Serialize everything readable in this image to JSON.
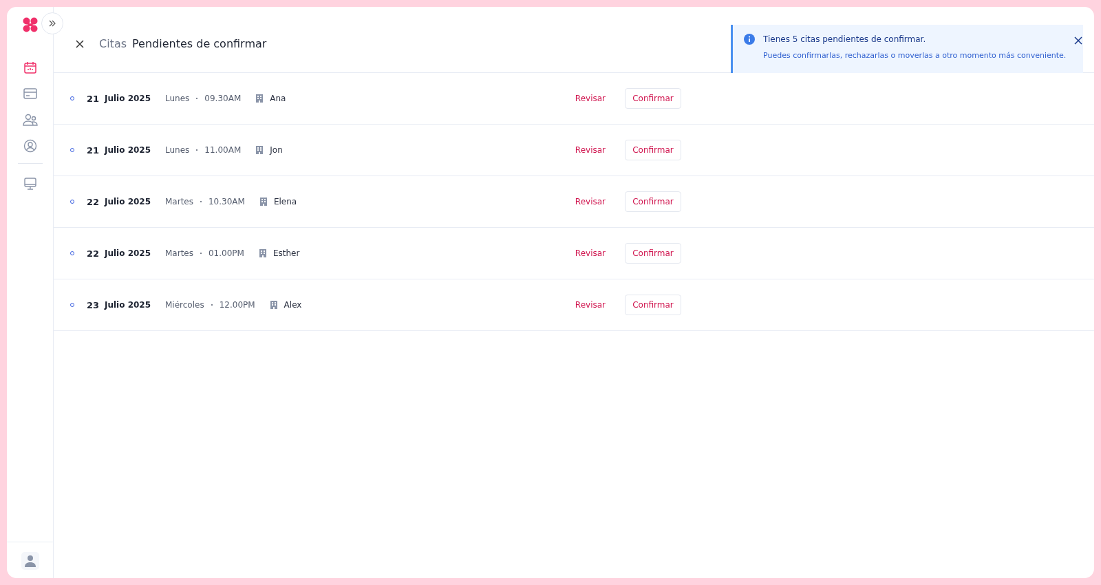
{
  "sidebar": {
    "items": [
      {
        "kind": "calendar",
        "selected": true
      },
      {
        "kind": "card",
        "selected": false
      },
      {
        "kind": "users",
        "selected": false
      },
      {
        "kind": "user",
        "selected": false
      },
      {
        "kind": "monitor",
        "selected": false
      }
    ]
  },
  "header": {
    "breadcrumb": "Citas",
    "title": "Pendientes de confirmar"
  },
  "notice": {
    "title": "Tienes 5 citas pendientes de confirmar.",
    "message": "Puedes confirmarlas, rechazarlas o moverlas a otro momento más conveniente."
  },
  "appointments": [
    {
      "day": "21",
      "month": "Julio 2025",
      "weekday": "Lunes",
      "time": "09.30AM",
      "name": "Ana",
      "review": "Revisar",
      "confirm": "Confirmar"
    },
    {
      "day": "21",
      "month": "Julio 2025",
      "weekday": "Lunes",
      "time": "11.00AM",
      "name": "Jon",
      "review": "Revisar",
      "confirm": "Confirmar"
    },
    {
      "day": "22",
      "month": "Julio 2025",
      "weekday": "Martes",
      "time": "10.30AM",
      "name": "Elena",
      "review": "Revisar",
      "confirm": "Confirmar"
    },
    {
      "day": "22",
      "month": "Julio 2025",
      "weekday": "Martes",
      "time": "01.00PM",
      "name": "Esther",
      "review": "Revisar",
      "confirm": "Confirmar"
    },
    {
      "day": "23",
      "month": "Julio 2025",
      "weekday": "Miércoles",
      "time": "12.00PM",
      "name": "Alex",
      "review": "Revisar",
      "confirm": "Confirmar"
    }
  ]
}
